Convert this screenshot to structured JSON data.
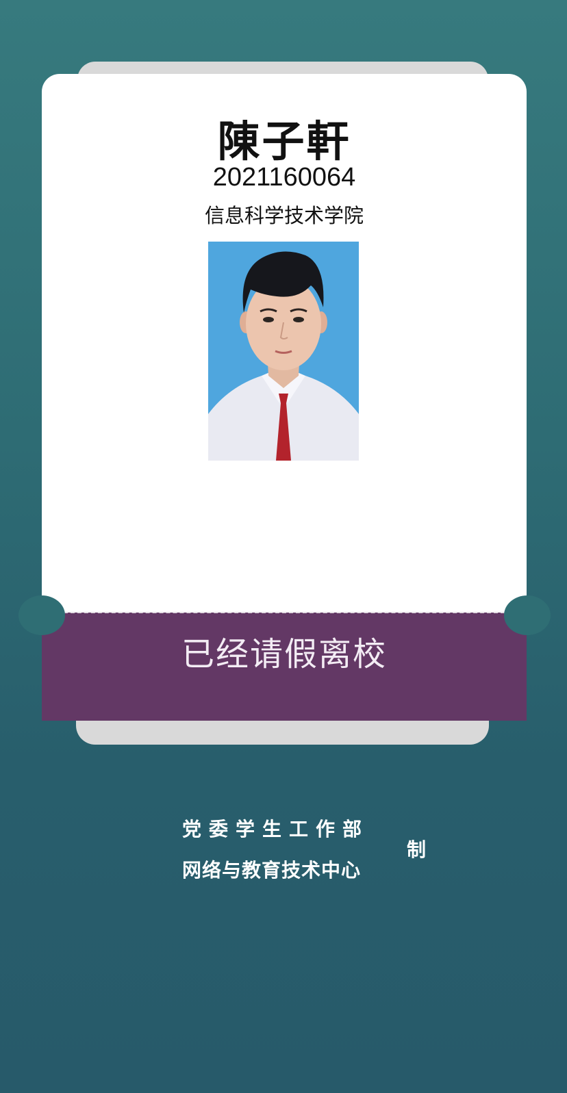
{
  "student": {
    "name": "陳子軒",
    "id": "2021160064",
    "college": "信息科学技术学院",
    "photo_icon": "student-portrait-photo"
  },
  "status": {
    "label": "已经请假离校"
  },
  "footer": {
    "line1": "党委学生工作部",
    "line2": "网络与教育技术中心",
    "made": "制"
  },
  "colors": {
    "background": "#2e6c74",
    "card": "#ffffff",
    "status_band": "#633865",
    "photo_background": "#4fa6de"
  }
}
